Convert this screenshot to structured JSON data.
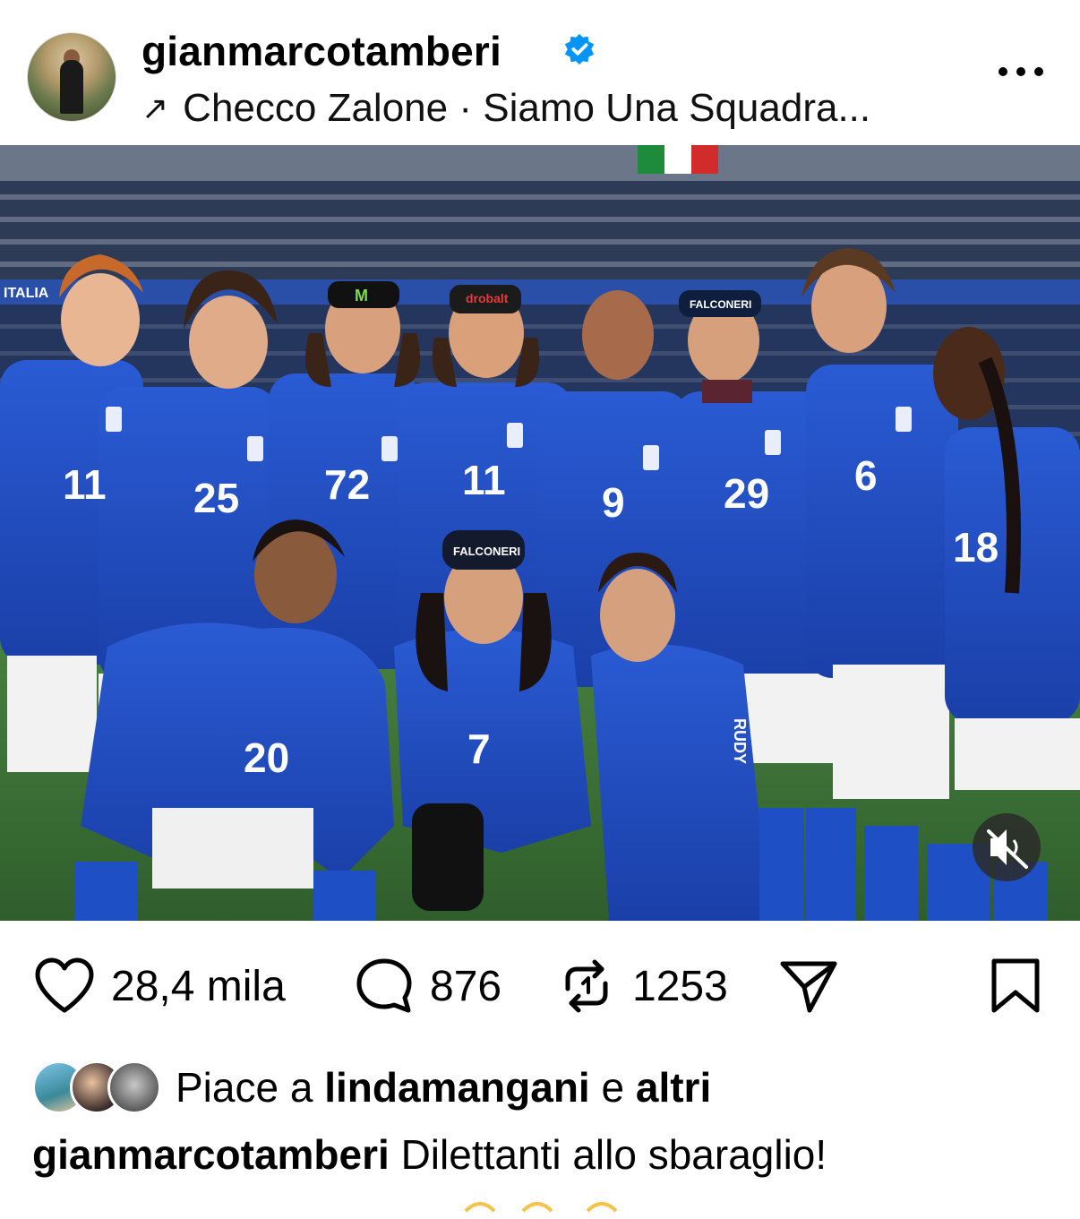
{
  "post": {
    "username": "gianmarcotamberi",
    "verified": true,
    "audio_arrow": "↗",
    "audio": "Checco Zalone · Siamo Una Squadra...",
    "more_icon": "more-horizontal-icon"
  },
  "media": {
    "jersey_numbers_back_row": [
      "11",
      "25",
      "72",
      "11",
      "9",
      "29",
      "6",
      "18"
    ],
    "jersey_numbers_front_row": [
      "20",
      "7"
    ],
    "sponsor_cap_text": [
      "drobalt",
      "FALCONERI"
    ],
    "beanie_text": "FALCONERI",
    "suit_text": "RUDY",
    "mute_icon": "speaker-muted-icon"
  },
  "actions": {
    "like_count": "28,4 mila",
    "comment_count": "876",
    "repost_count": "1253",
    "like_icon": "heart-icon",
    "comment_icon": "comment-icon",
    "repost_icon": "repost-icon",
    "share_icon": "send-icon",
    "save_icon": "bookmark-icon"
  },
  "likes": {
    "prefix": "Piace a",
    "user": "lindamangani",
    "joiner": "e",
    "others": "altri"
  },
  "caption": {
    "username": "gianmarcotamberi",
    "text": "Dilettanti allo sbaraglio!"
  },
  "colors": {
    "verified_blue": "#0095f6",
    "jersey_blue": "#1f4fc4",
    "pitch_green": "#3f7a3a"
  }
}
